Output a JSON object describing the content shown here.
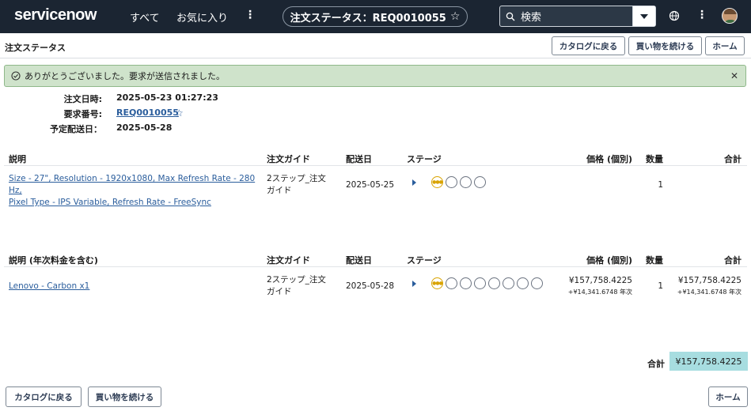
{
  "nav": {
    "logo": "servicenow",
    "all": "すべて",
    "favorites": "お気に入り",
    "title": "注文ステータス：REQ0010055",
    "search_placeholder": "検索",
    "colors": {
      "background": "#1b2532",
      "accent": "#62d84e"
    }
  },
  "page": {
    "title": "注文ステータス",
    "back_to_catalog": "カタログに戻る",
    "continue_shopping": "買い物を続ける",
    "home": "ホーム"
  },
  "alert": {
    "message": "ありがとうございました。要求が送信されました。",
    "color": "#cfe3cb"
  },
  "order": {
    "order_date_label": "注文日時:",
    "order_date": "2025-05-23 01:27:23",
    "request_number_label": "要求番号:",
    "request_number": "REQ0010055",
    "delivery_date_label": "予定配送日：",
    "delivery_date": "2025-05-28"
  },
  "table1": {
    "headers": [
      "説明",
      "注文ガイド",
      "配送日",
      "ステージ",
      "価格 (個別)",
      "数量",
      "合計"
    ],
    "rows": [
      {
        "description_line1": "Size - 27\", Resolution - 1920x1080, Max Refresh Rate - 280 Hz,",
        "description_line2": "Pixel Type - IPS Variable, Refresh Rate - FreeSync",
        "guide_line1": "2ステップ_注文",
        "guide_line2": "ガイド",
        "delivery": "2025-05-25",
        "stage_steps": 4,
        "price": "",
        "quantity": "1",
        "total": ""
      }
    ]
  },
  "table2": {
    "headers": [
      "説明 (年次料金を含む)",
      "注文ガイド",
      "配送日",
      "ステージ",
      "価格 (個別)",
      "数量",
      "合計"
    ],
    "rows": [
      {
        "description": "Lenovo - Carbon x1",
        "guide_line1": "2ステップ_注文",
        "guide_line2": "ガイド",
        "delivery": "2025-05-28",
        "stage_steps": 8,
        "price": "¥157,758.4225",
        "price_annual": "+¥14,341.6748 年次",
        "quantity": "1",
        "total": "¥157,758.4225",
        "total_annual": "+¥14,341.6748 年次"
      }
    ]
  },
  "summary": {
    "total_label": "合計",
    "total_value": "¥157,758.4225",
    "highlight_color": "#a7dde0"
  },
  "footer": {
    "back_to_catalog": "カタログに戻る",
    "continue_shopping": "買い物を続ける",
    "home": "ホーム"
  }
}
